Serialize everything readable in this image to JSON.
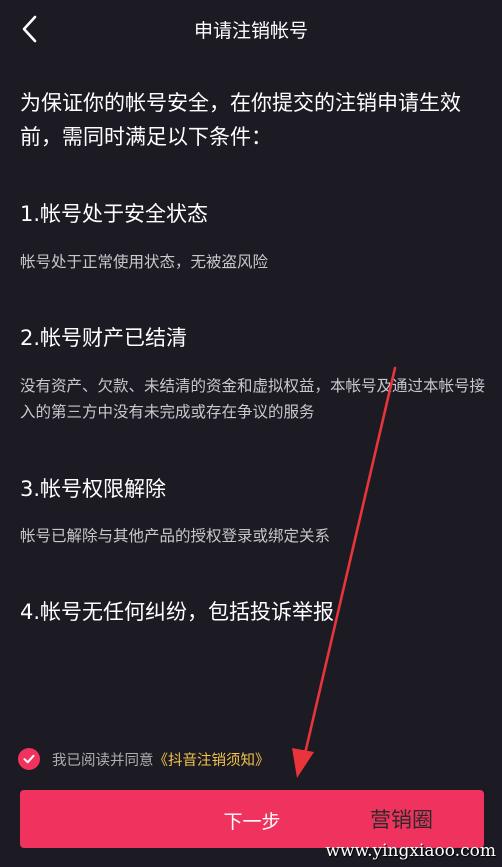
{
  "header": {
    "title": "申请注销帐号",
    "back_icon": "chevron-left-icon"
  },
  "intro": "为保证你的帐号安全，在你提交的注销申请生效前，需同时满足以下条件：",
  "sections": [
    {
      "title": "1.帐号处于安全状态",
      "desc": "帐号处于正常使用状态，无被盗风险"
    },
    {
      "title": "2.帐号财产已结清",
      "desc": "没有资产、欠款、未结清的资金和虚拟权益，本帐号及通过本帐号接入的第三方中没有未完成或存在争议的服务"
    },
    {
      "title": "3.帐号权限解除",
      "desc": "帐号已解除与其他产品的授权登录或绑定关系"
    },
    {
      "title": "4.帐号无任何纠纷，包括投诉举报",
      "desc": ""
    }
  ],
  "agreement": {
    "checked": true,
    "text": "我已阅读并同意",
    "link": "《抖音注销须知》"
  },
  "next_button": {
    "label": "下一步"
  },
  "watermark": {
    "title": "营销圈",
    "url": "www.yingxiaoo.com"
  },
  "colors": {
    "background": "#1c1b24",
    "accent": "#f0335e",
    "link": "#f3c34d",
    "annotation_arrow": "#e8343a"
  }
}
